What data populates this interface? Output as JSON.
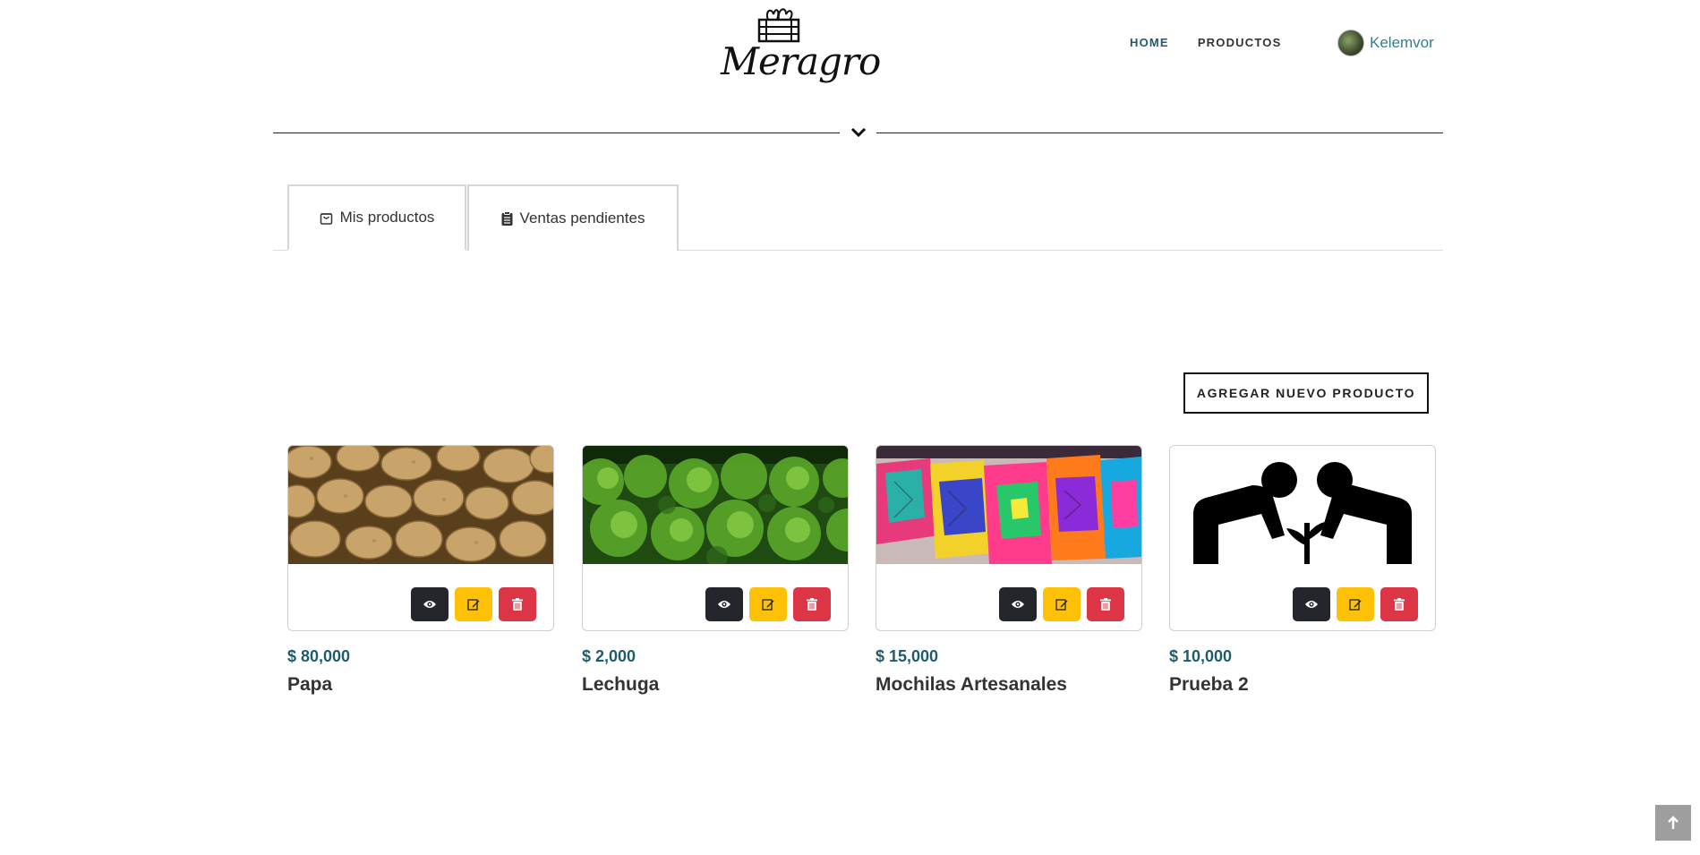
{
  "brand": {
    "logo_text": "Meragro"
  },
  "nav": {
    "home": "HOME",
    "products": "PRODUCTOS"
  },
  "user": {
    "name": "Kelemvor"
  },
  "tabs": [
    {
      "label": "Mis productos",
      "icon": "shopping-bag-icon",
      "active": true
    },
    {
      "label": "Ventas pendientes",
      "icon": "clipboard-icon",
      "active": false
    }
  ],
  "actions": {
    "add_product": "AGREGAR NUEVO PRODUCTO"
  },
  "products": [
    {
      "price": "$ 80,000",
      "name": "Papa",
      "image": "potatoes-image"
    },
    {
      "price": "$ 2,000",
      "name": "Lechuga",
      "image": "lettuce-image"
    },
    {
      "price": "$ 15,000",
      "name": "Mochilas Artesanales",
      "image": "handcrafted-bags-image"
    },
    {
      "price": "$ 10,000",
      "name": "Prueba 2",
      "image": "people-planting-icon-image"
    }
  ],
  "colors": {
    "accent": "#1f5c6b",
    "view_button": "#23272b",
    "edit_button": "#ffc107",
    "delete_button": "#dc3545"
  }
}
